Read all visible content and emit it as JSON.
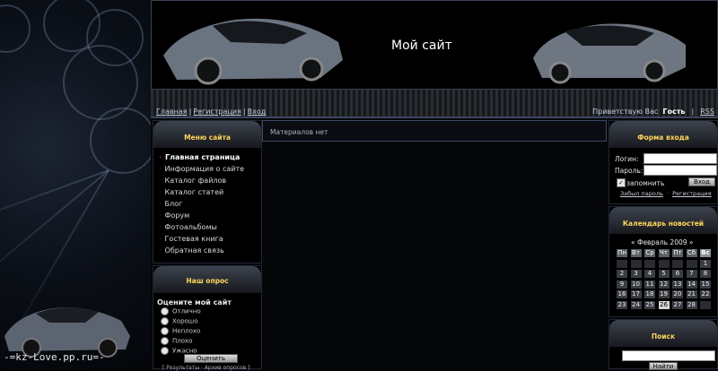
{
  "site": {
    "title": "Мой сайт",
    "watermark": "-=kz-Love.pp.ru=-"
  },
  "nav": {
    "left": [
      "Главная",
      "Регистрация",
      "Вход"
    ],
    "greeting": "Приветствую Вас",
    "user": "Гость",
    "rss": "RSS"
  },
  "menu": {
    "title": "Меню сайта",
    "items": [
      "Главная страница",
      "Информация о сайте",
      "Каталог файлов",
      "Каталог статей",
      "Блог",
      "Форум",
      "Фотоальбомы",
      "Гостевая книга",
      "Обратная связь"
    ]
  },
  "poll": {
    "title": "Наш опрос",
    "question": "Оцените мой сайт",
    "options": [
      "Отлично",
      "Хорошо",
      "Неплохо",
      "Плохо",
      "Ужасно"
    ],
    "button": "Оценить",
    "footer": "[ Результаты · Архив опросов ]"
  },
  "main": {
    "empty_text": "Материалов нет"
  },
  "login": {
    "title": "Форма входа",
    "login_label": "Логин:",
    "password_label": "Пароль:",
    "remember": "запомнить",
    "button": "Вход",
    "forgot": "Забыл пароль",
    "register": "Регистрация"
  },
  "calendar": {
    "title": "Календарь новостей",
    "month": "Февраль 2009",
    "prev": "«",
    "next": "»",
    "weekdays": [
      "Пн",
      "Вт",
      "Ср",
      "Чт",
      "Пт",
      "Сб",
      "Вс"
    ],
    "rows": [
      [
        "",
        "",
        "",
        "",
        "",
        "",
        "1"
      ],
      [
        "2",
        "3",
        "4",
        "5",
        "6",
        "7",
        "8"
      ],
      [
        "9",
        "10",
        "11",
        "12",
        "13",
        "14",
        "15"
      ],
      [
        "16",
        "17",
        "18",
        "19",
        "20",
        "21",
        "22"
      ],
      [
        "23",
        "24",
        "25",
        "26",
        "27",
        "28",
        ""
      ]
    ],
    "today": "26"
  },
  "search": {
    "title": "Поиск",
    "button": "Найти"
  }
}
